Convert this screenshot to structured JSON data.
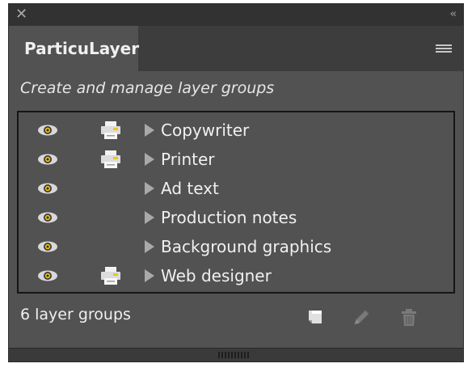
{
  "panel": {
    "close_icon": "close-icon",
    "collapse_icon": "collapse-chevrons-icon",
    "tab_title": "ParticuLayer",
    "menu_icon": "hamburger-menu-icon",
    "subtitle": "Create and manage layer groups"
  },
  "groups": [
    {
      "label": "Copywriter",
      "visible": true,
      "print": true
    },
    {
      "label": "Printer",
      "visible": true,
      "print": true
    },
    {
      "label": "Ad text",
      "visible": true,
      "print": false
    },
    {
      "label": "Production notes",
      "visible": true,
      "print": false
    },
    {
      "label": "Background graphics",
      "visible": true,
      "print": false
    },
    {
      "label": "Web designer",
      "visible": true,
      "print": true
    }
  ],
  "footer": {
    "count_text": "6 layer groups",
    "tools": [
      "new-group-icon",
      "edit-pencil-icon",
      "trash-icon"
    ]
  },
  "colors": {
    "panel_bg": "#525252",
    "accent_yellow": "#f0c419",
    "text": "#f0f0f0"
  }
}
